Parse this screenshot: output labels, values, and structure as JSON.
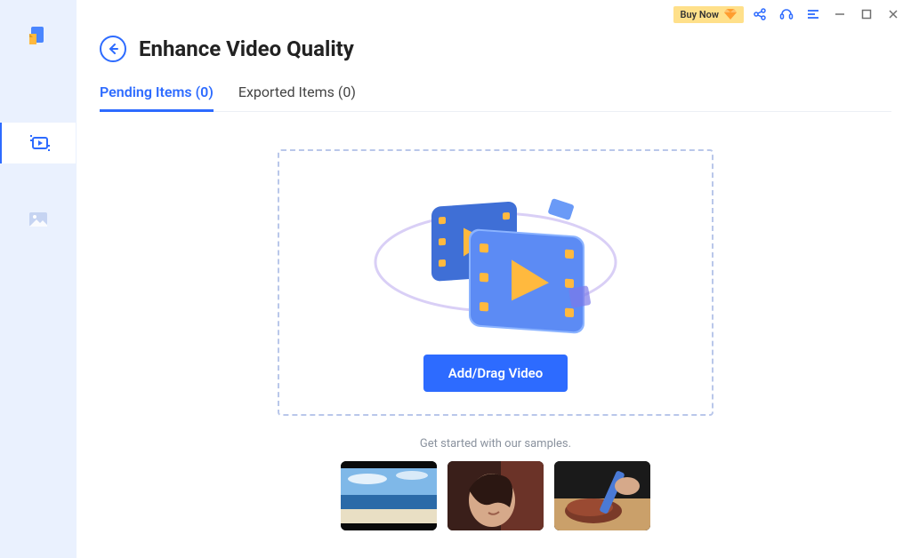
{
  "titlebar": {
    "buy_now_label": "Buy Now"
  },
  "page": {
    "title": "Enhance Video Quality"
  },
  "tabs": {
    "pending": {
      "label": "Pending Items (0)"
    },
    "exported": {
      "label": "Exported Items (0)"
    }
  },
  "dropzone": {
    "button_label": "Add/Drag Video"
  },
  "samples": {
    "label": "Get started with our samples.",
    "items": [
      "sample-beach",
      "sample-portrait",
      "sample-cooking"
    ]
  }
}
